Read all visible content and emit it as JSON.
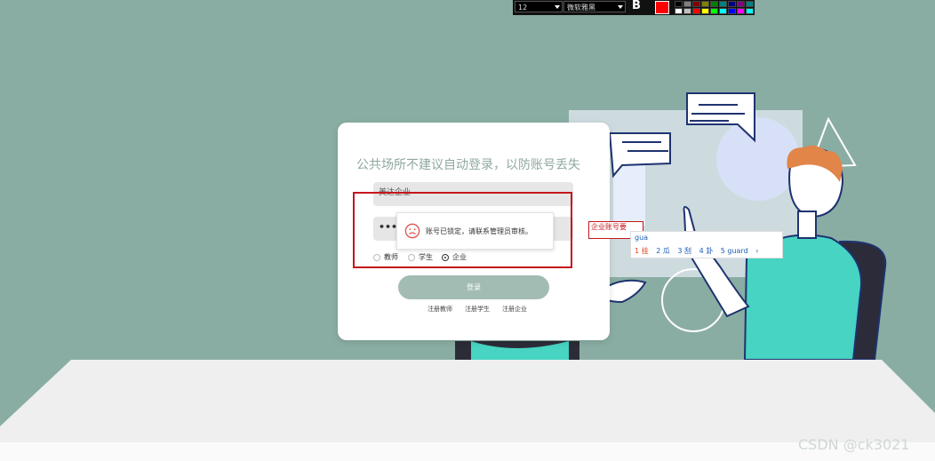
{
  "toolbar": {
    "font_size": "12",
    "font_name": "微软雅黑",
    "bold_label": "B",
    "current_color": "#ff0000",
    "swatches": [
      "#000000",
      "#808080",
      "#800000",
      "#808000",
      "#008000",
      "#008080",
      "#000080",
      "#800080",
      "#008080",
      "#ffffff",
      "#c0c0c0",
      "#ff0000",
      "#ffff00",
      "#00ff00",
      "#00ffff",
      "#0000ff",
      "#ff00ff",
      "#00ffff"
    ]
  },
  "login": {
    "title": "公共场所不建议自动登录，以防账号丢失",
    "username_value": "美达企业",
    "password_value": "•••",
    "roles": [
      {
        "label": "教师",
        "selected": false
      },
      {
        "label": "学生",
        "selected": false
      },
      {
        "label": "企业",
        "selected": true
      }
    ],
    "login_button": "登录",
    "register_links": [
      "注册教师",
      "注册学生",
      "注册企业"
    ]
  },
  "toast": {
    "message": "账号已锁定，请联系管理员审核。"
  },
  "overlay_input": {
    "value": "企业账号要"
  },
  "ime": {
    "composition": "gua",
    "candidates": [
      "1 挂",
      "2 瓜",
      "3 刮",
      "4 卦",
      "5 guard"
    ],
    "next_label": "›"
  },
  "watermark": "CSDN @ck3021"
}
